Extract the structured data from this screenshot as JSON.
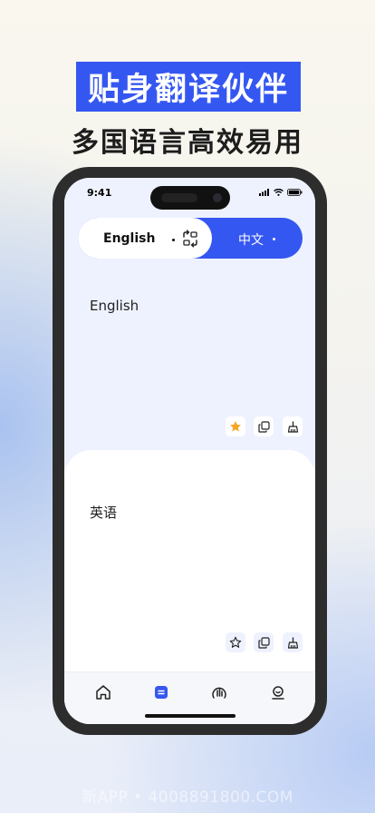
{
  "promo": {
    "headline": "贴身翻译伙伴",
    "subline": "多国语言高效易用"
  },
  "status_bar": {
    "time": "9:41"
  },
  "language_bar": {
    "source": "English",
    "target": "中文"
  },
  "source_panel": {
    "text": "English"
  },
  "target_panel": {
    "text": "英语"
  },
  "tabs": [
    "home",
    "translate",
    "voice",
    "profile"
  ],
  "colors": {
    "accent": "#3557f1",
    "star": "#f5a623"
  },
  "watermark": "新APP • 4008891800.COM"
}
